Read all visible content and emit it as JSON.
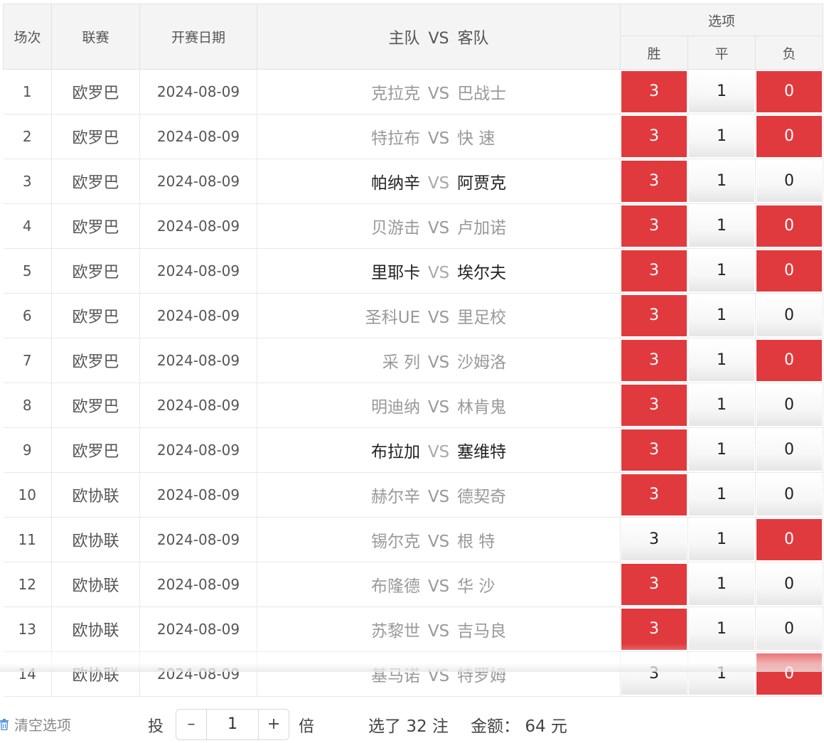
{
  "header": {
    "col_no": "场次",
    "col_league": "联赛",
    "col_date": "开赛日期",
    "col_home": "主队",
    "col_vs": "VS",
    "col_away": "客队",
    "col_options": "选项",
    "opt_win": "胜",
    "opt_draw": "平",
    "opt_loss": "负"
  },
  "rows": [
    {
      "no": "1",
      "league": "欧罗巴",
      "date": "2024-08-09",
      "home": "克拉克",
      "vs": "VS",
      "away": "巴战士",
      "style": "grey",
      "opts": [
        {
          "label": "3",
          "selected": true
        },
        {
          "label": "1",
          "selected": false
        },
        {
          "label": "0",
          "selected": true
        }
      ]
    },
    {
      "no": "2",
      "league": "欧罗巴",
      "date": "2024-08-09",
      "home": "特拉布",
      "vs": "VS",
      "away": "快 速",
      "style": "grey",
      "opts": [
        {
          "label": "3",
          "selected": true
        },
        {
          "label": "1",
          "selected": false
        },
        {
          "label": "0",
          "selected": true
        }
      ]
    },
    {
      "no": "3",
      "league": "欧罗巴",
      "date": "2024-08-09",
      "home": "帕纳辛",
      "vs": "VS",
      "away": "阿贾克",
      "style": "dark",
      "opts": [
        {
          "label": "3",
          "selected": true
        },
        {
          "label": "1",
          "selected": false
        },
        {
          "label": "0",
          "selected": false
        }
      ]
    },
    {
      "no": "4",
      "league": "欧罗巴",
      "date": "2024-08-09",
      "home": "贝游击",
      "vs": "VS",
      "away": "卢加诺",
      "style": "grey",
      "opts": [
        {
          "label": "3",
          "selected": true
        },
        {
          "label": "1",
          "selected": false
        },
        {
          "label": "0",
          "selected": true
        }
      ]
    },
    {
      "no": "5",
      "league": "欧罗巴",
      "date": "2024-08-09",
      "home": "里耶卡",
      "vs": "VS",
      "away": "埃尔夫",
      "style": "dark",
      "opts": [
        {
          "label": "3",
          "selected": true
        },
        {
          "label": "1",
          "selected": false
        },
        {
          "label": "0",
          "selected": true
        }
      ]
    },
    {
      "no": "6",
      "league": "欧罗巴",
      "date": "2024-08-09",
      "home": "圣科UE",
      "vs": "VS",
      "away": "里足校",
      "style": "grey",
      "opts": [
        {
          "label": "3",
          "selected": true
        },
        {
          "label": "1",
          "selected": false
        },
        {
          "label": "0",
          "selected": false
        }
      ]
    },
    {
      "no": "7",
      "league": "欧罗巴",
      "date": "2024-08-09",
      "home": "采 列",
      "vs": "VS",
      "away": "沙姆洛",
      "style": "grey",
      "opts": [
        {
          "label": "3",
          "selected": true
        },
        {
          "label": "1",
          "selected": false
        },
        {
          "label": "0",
          "selected": true
        }
      ]
    },
    {
      "no": "8",
      "league": "欧罗巴",
      "date": "2024-08-09",
      "home": "明迪纳",
      "vs": "VS",
      "away": "林肯鬼",
      "style": "grey",
      "opts": [
        {
          "label": "3",
          "selected": true
        },
        {
          "label": "1",
          "selected": false
        },
        {
          "label": "0",
          "selected": false
        }
      ]
    },
    {
      "no": "9",
      "league": "欧罗巴",
      "date": "2024-08-09",
      "home": "布拉加",
      "vs": "VS",
      "away": "塞维特",
      "style": "dark",
      "opts": [
        {
          "label": "3",
          "selected": true
        },
        {
          "label": "1",
          "selected": false
        },
        {
          "label": "0",
          "selected": false
        }
      ]
    },
    {
      "no": "10",
      "league": "欧协联",
      "date": "2024-08-09",
      "home": "赫尔辛",
      "vs": "VS",
      "away": "德契奇",
      "style": "grey",
      "opts": [
        {
          "label": "3",
          "selected": true
        },
        {
          "label": "1",
          "selected": false
        },
        {
          "label": "0",
          "selected": false
        }
      ]
    },
    {
      "no": "11",
      "league": "欧协联",
      "date": "2024-08-09",
      "home": "锡尔克",
      "vs": "VS",
      "away": "根 特",
      "style": "grey",
      "opts": [
        {
          "label": "3",
          "selected": false
        },
        {
          "label": "1",
          "selected": false
        },
        {
          "label": "0",
          "selected": true
        }
      ]
    },
    {
      "no": "12",
      "league": "欧协联",
      "date": "2024-08-09",
      "home": "布隆德",
      "vs": "VS",
      "away": "华 沙",
      "style": "grey",
      "opts": [
        {
          "label": "3",
          "selected": true
        },
        {
          "label": "1",
          "selected": false
        },
        {
          "label": "0",
          "selected": false
        }
      ]
    },
    {
      "no": "13",
      "league": "欧协联",
      "date": "2024-08-09",
      "home": "苏黎世",
      "vs": "VS",
      "away": "吉马良",
      "style": "grey",
      "opts": [
        {
          "label": "3",
          "selected": true
        },
        {
          "label": "1",
          "selected": false
        },
        {
          "label": "0",
          "selected": false
        }
      ]
    },
    {
      "no": "14",
      "league": "欧协联",
      "date": "2024-08-09",
      "home": "基马诺",
      "vs": "VS",
      "away": "特罗姆",
      "style": "grey",
      "opts": [
        {
          "label": "3",
          "selected": false
        },
        {
          "label": "1",
          "selected": false
        },
        {
          "label": "0",
          "selected": true
        }
      ]
    }
  ],
  "footer": {
    "clear_label": "清空选项",
    "bet_label": "投",
    "minus": "–",
    "multiplier": "1",
    "plus": "+",
    "times_label": "倍",
    "selected_prefix": "选了",
    "selected_count": "32",
    "selected_suffix": "注",
    "amount_label": "金额：",
    "amount_value": "64",
    "amount_unit": "元"
  },
  "colors": {
    "selected": "#e03a3e",
    "header_bg": "#f4f4f4"
  },
  "icons": {
    "clear": "trash-icon"
  }
}
